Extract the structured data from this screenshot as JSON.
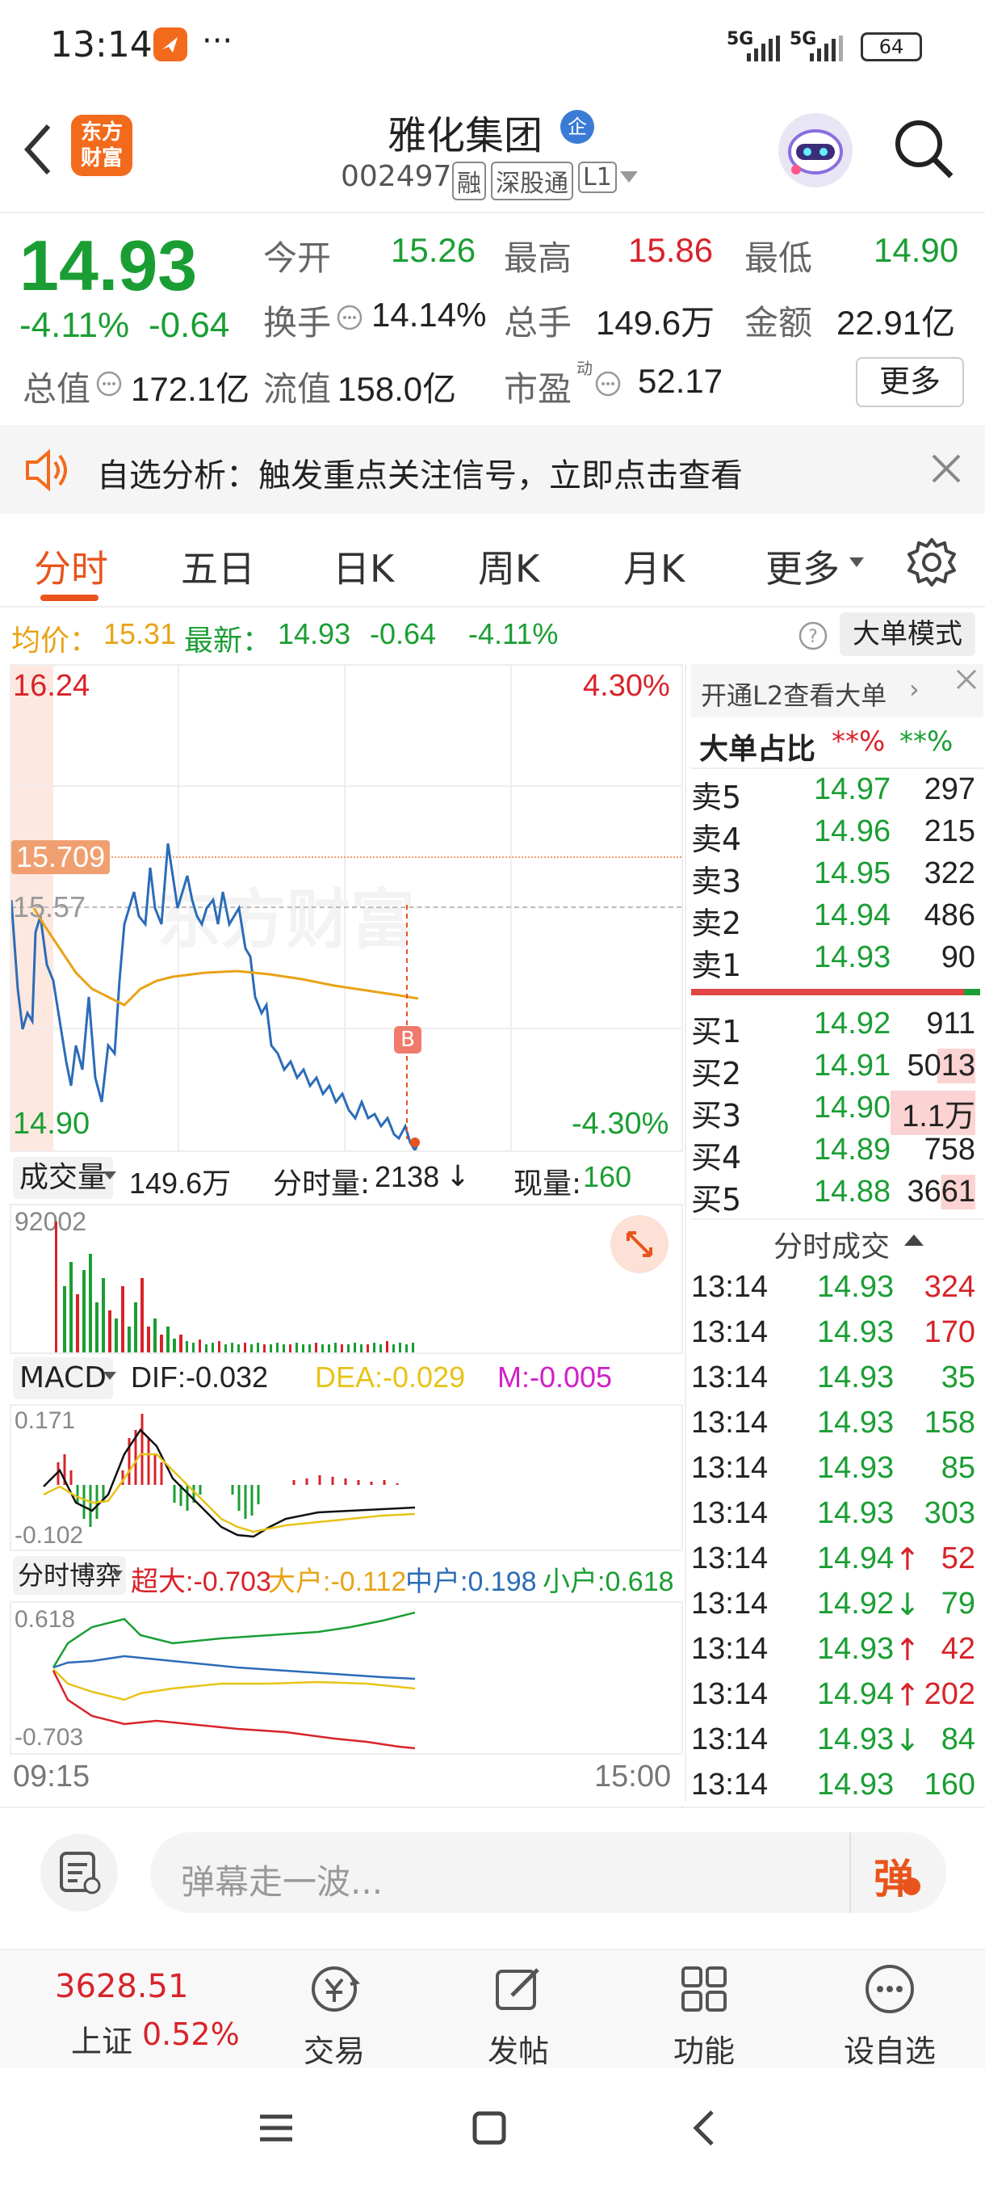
{
  "status_bar": {
    "time": "13:14",
    "dots": "···",
    "net1": "5G",
    "net2": "5G",
    "battery": "64"
  },
  "header": {
    "title": "雅化集团",
    "verified_badge": "企",
    "code": "002497",
    "tag1": "融",
    "tag2": "深股通",
    "tag3": "L1",
    "logo_line1": "东方",
    "logo_line2": "财富"
  },
  "quote": {
    "price": "14.93",
    "change_pct": "-4.11%",
    "change": "-0.64",
    "open_label": "今开",
    "open": "15.26",
    "high_label": "最高",
    "high": "15.86",
    "low_label": "最低",
    "low": "14.90",
    "turnover_label": "换手",
    "turnover": "14.14%",
    "volume_label": "总手",
    "volume": "149.6万",
    "amount_label": "金额",
    "amount": "22.91亿",
    "mktcap_label": "总值",
    "mktcap": "172.1亿",
    "float_label": "流值",
    "float": "158.0亿",
    "pe_label": "市盈",
    "pe_sup": "动",
    "pe": "52.17",
    "more": "更多"
  },
  "notice": {
    "text": "自选分析：触发重点关注信号，立即点击查看"
  },
  "tabs": [
    {
      "label": "分时"
    },
    {
      "label": "五日"
    },
    {
      "label": "日K"
    },
    {
      "label": "周K"
    },
    {
      "label": "月K"
    },
    {
      "label": "更多"
    }
  ],
  "info_line": {
    "avg_label": "均价：",
    "avg": "15.31",
    "latest_label": "最新：",
    "latest": "14.93",
    "chg": "-0.64",
    "pct": "-4.11%",
    "mode": "大单模式"
  },
  "chart": {
    "price_high": "16.24",
    "price_low": "14.90",
    "pct_high": "4.30%",
    "pct_low": "-4.30%",
    "mark_price": "15.709",
    "prev_close": "15.57",
    "b_marker": "B",
    "watermark": "东方财富",
    "time_start": "09:15",
    "time_end": "15:00"
  },
  "volume_bar": {
    "label": "成交量",
    "total": "149.6万",
    "tick_label": "分时量:",
    "tick": "2138",
    "now_label": "现量:",
    "now": "160",
    "max": "92002"
  },
  "macd": {
    "label": "MACD",
    "dif": "DIF:-0.032",
    "dea": "DEA:-0.029",
    "m": "M:-0.005",
    "top": "0.171",
    "bottom": "-0.102"
  },
  "flow": {
    "label": "分时博弈",
    "super": "超大:-0.703",
    "big": "大户:-0.112",
    "mid": "中户:0.198",
    "small": "小户:0.618",
    "top": "0.618",
    "bottom": "-0.703"
  },
  "orderbook": {
    "l2_text": "开通L2查看大单",
    "ratio_label": "大单占比",
    "ratio_red": "**%",
    "ratio_green": "**%",
    "asks": [
      {
        "label": "卖5",
        "price": "14.97",
        "vol": "297"
      },
      {
        "label": "卖4",
        "price": "14.96",
        "vol": "215"
      },
      {
        "label": "卖3",
        "price": "14.95",
        "vol": "322"
      },
      {
        "label": "卖2",
        "price": "14.94",
        "vol": "486"
      },
      {
        "label": "卖1",
        "price": "14.93",
        "vol": "90"
      }
    ],
    "bids": [
      {
        "label": "买1",
        "price": "14.92",
        "vol": "911"
      },
      {
        "label": "买2",
        "price": "14.91",
        "vol": "5013"
      },
      {
        "label": "买3",
        "price": "14.90",
        "vol": "1.1万"
      },
      {
        "label": "买4",
        "price": "14.89",
        "vol": "758"
      },
      {
        "label": "买5",
        "price": "14.88",
        "vol": "3661"
      }
    ],
    "trades_title": "分时成交",
    "trades": [
      {
        "time": "13:14",
        "price": "14.93",
        "arrow": "",
        "vol": "324"
      },
      {
        "time": "13:14",
        "price": "14.93",
        "arrow": "",
        "vol": "170"
      },
      {
        "time": "13:14",
        "price": "14.93",
        "arrow": "",
        "vol": "35"
      },
      {
        "time": "13:14",
        "price": "14.93",
        "arrow": "",
        "vol": "158"
      },
      {
        "time": "13:14",
        "price": "14.93",
        "arrow": "",
        "vol": "85"
      },
      {
        "time": "13:14",
        "price": "14.93",
        "arrow": "",
        "vol": "303"
      },
      {
        "time": "13:14",
        "price": "14.94",
        "arrow": "↑",
        "vol": "52"
      },
      {
        "time": "13:14",
        "price": "14.92",
        "arrow": "↓",
        "vol": "79"
      },
      {
        "time": "13:14",
        "price": "14.93",
        "arrow": "↑",
        "vol": "42"
      },
      {
        "time": "13:14",
        "price": "14.94",
        "arrow": "↑",
        "vol": "202"
      },
      {
        "time": "13:14",
        "price": "14.93",
        "arrow": "↓",
        "vol": "84"
      },
      {
        "time": "13:14",
        "price": "14.93",
        "arrow": "",
        "vol": "160"
      }
    ]
  },
  "comment": {
    "placeholder": "弹幕走一波...",
    "danmu": "弹"
  },
  "bottom_nav": {
    "index_value": "3628.51",
    "index_name": "上证",
    "index_pct": "0.52%",
    "items": [
      {
        "label": "交易"
      },
      {
        "label": "发帖"
      },
      {
        "label": "功能"
      },
      {
        "label": "设自选"
      }
    ]
  }
}
